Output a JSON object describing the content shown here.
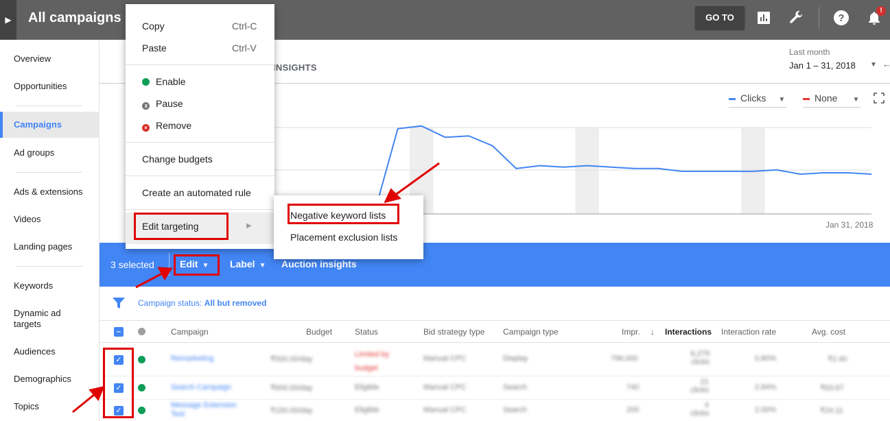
{
  "header": {
    "title": "All campaigns",
    "goto_label": "GO TO"
  },
  "sidebar": {
    "items": [
      {
        "label": "Overview"
      },
      {
        "label": "Opportunities"
      },
      {
        "label": "Campaigns"
      },
      {
        "label": "Ad groups"
      },
      {
        "label": "Ads & extensions"
      },
      {
        "label": "Videos"
      },
      {
        "label": "Landing pages"
      },
      {
        "label": "Keywords"
      },
      {
        "label": "Dynamic ad targets"
      },
      {
        "label": "Audiences"
      },
      {
        "label": "Demographics"
      },
      {
        "label": "Topics"
      }
    ],
    "active": "Campaigns"
  },
  "tabs": {
    "insights_label": "INSIGHTS"
  },
  "date_range": {
    "label": "Last month",
    "value": "Jan 1 – 31, 2018"
  },
  "chart": {
    "metric1": "Clicks",
    "metric1_color": "#4285f4",
    "metric2": "None",
    "metric2_color": "#e53935",
    "end_date": "Jan 31, 2018"
  },
  "chart_data": {
    "type": "line",
    "series": [
      {
        "name": "Clicks",
        "values": [
          0,
          0,
          0,
          0,
          0,
          0,
          0,
          0,
          0,
          0,
          0,
          60,
          62,
          54,
          55,
          48,
          32,
          34,
          33,
          34,
          33,
          32,
          32,
          30,
          30,
          30,
          30,
          31,
          28,
          29,
          29,
          28
        ]
      }
    ]
  },
  "action_bar": {
    "selected": "3 selected",
    "edit": "Edit",
    "label": "Label",
    "auction": "Auction insights"
  },
  "filter": {
    "prefix": "Campaign status:",
    "value": "All but removed"
  },
  "table": {
    "headers": {
      "campaign": "Campaign",
      "budget": "Budget",
      "status": "Status",
      "bid": "Bid strategy type",
      "type": "Campaign type",
      "impr": "Impr.",
      "interactions": "Interactions",
      "rate": "Interaction rate",
      "cost": "Avg. cost"
    },
    "rows": [
      {
        "campaign": "Remarketing",
        "budget": "₹500.00/day",
        "status": "Limited by budget",
        "bid": "Manual CPC",
        "type": "Display",
        "impr": "796,000",
        "interactions": "6,279 clicks",
        "rate": "0.80%",
        "cost": "₹2.40"
      },
      {
        "campaign": "Search Campaign",
        "budget": "₹600.00/day",
        "status": "Eligible",
        "bid": "Manual CPC",
        "type": "Search",
        "impr": "740",
        "interactions": "21 clicks",
        "rate": "2.84%",
        "cost": "₹63.67"
      },
      {
        "campaign": "Message Extension Test",
        "budget": "₹150.00/day",
        "status": "Eligible",
        "bid": "Manual CPC",
        "type": "Search",
        "impr": "200",
        "interactions": "4 clicks",
        "rate": "2.00%",
        "cost": "₹24.11"
      }
    ]
  },
  "context_menu": {
    "copy": "Copy",
    "copy_shortcut": "Ctrl-C",
    "paste": "Paste",
    "paste_shortcut": "Ctrl-V",
    "enable": "Enable",
    "pause": "Pause",
    "remove": "Remove",
    "budgets": "Change budgets",
    "rule": "Create an automated rule",
    "targeting": "Edit targeting"
  },
  "submenu": {
    "negative": "Negative keyword lists",
    "placement": "Placement exclusion lists"
  },
  "colors": {
    "accent": "#4285f4",
    "enable": "#0f9d58",
    "pause": "#757575",
    "remove": "#d93025",
    "annotation": "#e00000"
  }
}
